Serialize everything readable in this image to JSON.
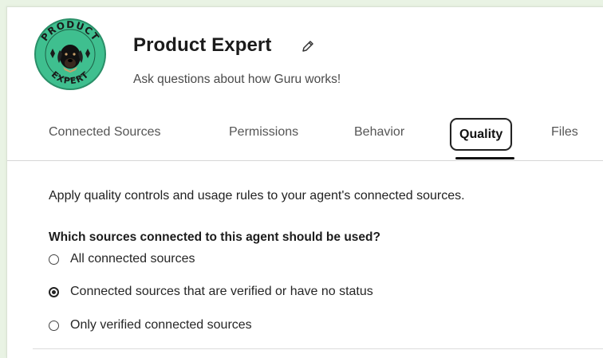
{
  "agent": {
    "name": "Product Expert",
    "description": "Ask questions about how Guru works!",
    "logo": {
      "top_text": "PRODUCT",
      "bottom_text": "EXPERT",
      "bg_color": "#3fbf8f"
    }
  },
  "tabs": [
    {
      "label": "Connected Sources",
      "active": false
    },
    {
      "label": "Permissions",
      "active": false
    },
    {
      "label": "Behavior",
      "active": false
    },
    {
      "label": "Quality",
      "active": true
    },
    {
      "label": "Files",
      "active": false
    }
  ],
  "quality": {
    "intro": "Apply quality controls and usage rules to your agent's connected sources.",
    "question": "Which sources connected to this agent should be used?",
    "options": [
      {
        "label": "All connected sources",
        "selected": false
      },
      {
        "label": "Connected sources that are verified or have no status",
        "selected": true
      },
      {
        "label": "Only verified connected sources",
        "selected": false
      }
    ]
  },
  "icons": {
    "edit": "pencil-icon"
  }
}
